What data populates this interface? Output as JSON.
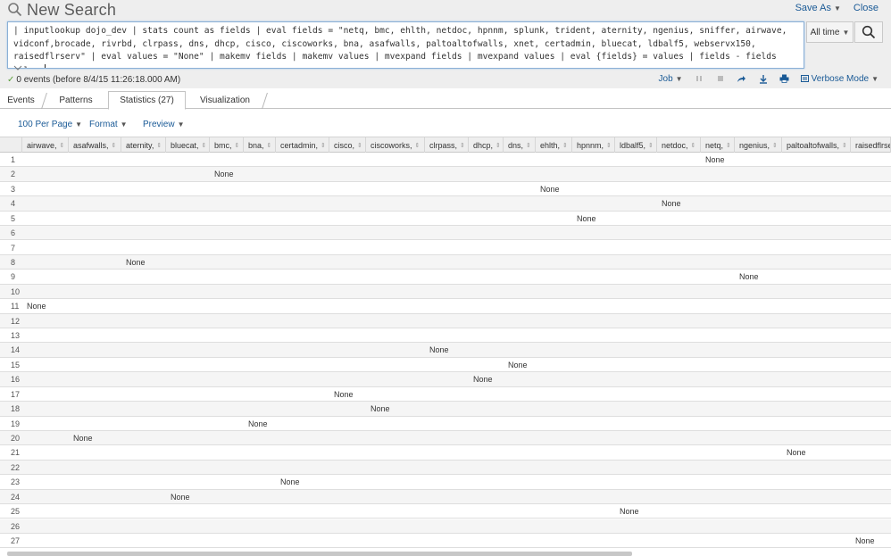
{
  "header": {
    "title": "New Search",
    "save_as": "Save As",
    "close": "Close"
  },
  "search": {
    "query": "| inputlookup dojo_dev | stats count as fields | eval fields = \"netq, bmc, ehlth, netdoc, hpnnm, splunk, trident, aternity, ngenius, sniffer, airwave, vidconf,brocade, rivrbd, clrpass, dns, dhcp, cisco, ciscoworks, bna, asafwalls, paltoaltofwalls, xnet, certadmin, bluecat, ldbalf5, webservx150, raisedflrserv\" | eval values = \"None\" | makemv fields | makemv values | mvexpand fields | mvexpand values | eval {fields} = values | fields - fields values",
    "time_range": "All time"
  },
  "status": {
    "text": "0 events (before 8/4/15 11:26:18.000 AM)",
    "job": "Job",
    "mode": "Verbose Mode"
  },
  "tabs": [
    {
      "label": "Events"
    },
    {
      "label": "Patterns"
    },
    {
      "label": "Statistics (27)"
    },
    {
      "label": "Visualization"
    }
  ],
  "toolbar": {
    "per_page": "100 Per Page",
    "format": "Format",
    "preview": "Preview"
  },
  "table": {
    "columns": [
      "airwave,",
      "asafwalls,",
      "aternity,",
      "bluecat,",
      "bmc,",
      "bna,",
      "certadmin,",
      "cisco,",
      "ciscoworks,",
      "clrpass,",
      "dhcp,",
      "dns,",
      "ehlth,",
      "hpnnm,",
      "ldbalf5,",
      "netdoc,",
      "netq,",
      "ngenius,",
      "paltoaltofwalls,",
      "raisedflrse"
    ],
    "rows": [
      {
        "num": "1",
        "col": 16,
        "value": "None"
      },
      {
        "num": "2",
        "col": 4,
        "value": "None"
      },
      {
        "num": "3",
        "col": 12,
        "value": "None"
      },
      {
        "num": "4",
        "col": 15,
        "value": "None"
      },
      {
        "num": "5",
        "col": 13,
        "value": "None"
      },
      {
        "num": "6",
        "col": -1,
        "value": ""
      },
      {
        "num": "7",
        "col": -1,
        "value": ""
      },
      {
        "num": "8",
        "col": 2,
        "value": "None"
      },
      {
        "num": "9",
        "col": 17,
        "value": "None"
      },
      {
        "num": "10",
        "col": -1,
        "value": ""
      },
      {
        "num": "11",
        "col": 0,
        "value": "None"
      },
      {
        "num": "12",
        "col": -1,
        "value": ""
      },
      {
        "num": "13",
        "col": -1,
        "value": ""
      },
      {
        "num": "14",
        "col": 9,
        "value": "None"
      },
      {
        "num": "15",
        "col": 11,
        "value": "None"
      },
      {
        "num": "16",
        "col": 10,
        "value": "None"
      },
      {
        "num": "17",
        "col": 7,
        "value": "None"
      },
      {
        "num": "18",
        "col": 8,
        "value": "None"
      },
      {
        "num": "19",
        "col": 5,
        "value": "None"
      },
      {
        "num": "20",
        "col": 1,
        "value": "None"
      },
      {
        "num": "21",
        "col": 18,
        "value": "None"
      },
      {
        "num": "22",
        "col": -1,
        "value": ""
      },
      {
        "num": "23",
        "col": 6,
        "value": "None"
      },
      {
        "num": "24",
        "col": 3,
        "value": "None"
      },
      {
        "num": "25",
        "col": 14,
        "value": "None"
      },
      {
        "num": "26",
        "col": -1,
        "value": ""
      },
      {
        "num": "27",
        "col": 19,
        "value": "None"
      }
    ]
  },
  "colors": {
    "link": "#1a5a96",
    "header_bg": "#eeeeee",
    "success": "#5a9e3a"
  },
  "icons": {
    "title": "magnifier-icon",
    "search_button": "magnifier-icon",
    "status": "check-icon",
    "print": "printer-icon"
  }
}
